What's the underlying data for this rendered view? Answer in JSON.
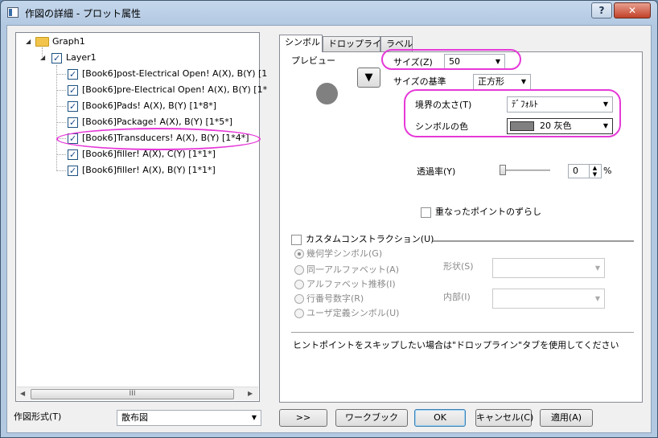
{
  "window": {
    "title": "作図の詳細 - プロット属性",
    "help_label": "?",
    "close_label": "✕"
  },
  "tree": {
    "root_label": "Graph1",
    "layer_label": "Layer1",
    "items": [
      {
        "label": "[Book6]post-Electrical Open! A(X), B(Y) [1",
        "checked": true
      },
      {
        "label": "[Book6]pre-Electrical Open! A(X), B(Y) [1*",
        "checked": true
      },
      {
        "label": "[Book6]Pads! A(X), B(Y) [1*8*]",
        "checked": true
      },
      {
        "label": "[Book6]Package! A(X), B(Y) [1*5*]",
        "checked": true
      },
      {
        "label": "[Book6]Transducers! A(X), B(Y) [1*4*]",
        "checked": true
      },
      {
        "label": "[Book6]filler! A(X), C(Y) [1*1*]",
        "checked": true
      },
      {
        "label": "[Book6]filler! A(X), B(Y) [1*1*]",
        "checked": true
      }
    ],
    "scroll_thumb": "III"
  },
  "bottom": {
    "plot_type_label": "作図形式(T)",
    "plot_type_value": "散布図",
    "more_button": ">>",
    "workbook_button": "ワークブック",
    "ok_button": "OK",
    "cancel_button": "キャンセル(C)",
    "apply_button": "適用(A)"
  },
  "tabs": [
    "シンボル",
    "ドロップライン",
    "ラベル"
  ],
  "symbol": {
    "preview_label": "プレビュー",
    "size_label": "サイズ(Z)",
    "size_value": "50",
    "size_basis_label": "サイズの基準",
    "size_basis_value": "正方形",
    "edge_width_label": "境界の太さ(T)",
    "edge_width_value": "ﾃﾞﾌｫﾙﾄ",
    "color_label": "シンボルの色",
    "color_value": "20 灰色",
    "transparency_label": "透過率(Y)",
    "transparency_value": "0",
    "transparency_unit": "%",
    "offset_label": "重なったポイントのずらし",
    "custom_label": "カスタムコンストラクション(U)",
    "radio_geometric": "幾何学シンボル(G)",
    "radio_same_letter": "同一アルファベット(A)",
    "radio_letter_increment": "アルファベット推移(I)",
    "radio_row_number": "行番号数字(R)",
    "radio_user_defined": "ユーザ定義シンボル(U)",
    "shape_label": "形状(S)",
    "interior_label": "内部(I)",
    "hint_text": "ヒントポイントをスキップしたい場合は\"ドロップライン\"タブを使用してください"
  },
  "colors": {
    "highlight": "#e639d8",
    "symbol_gray": "#808080"
  }
}
